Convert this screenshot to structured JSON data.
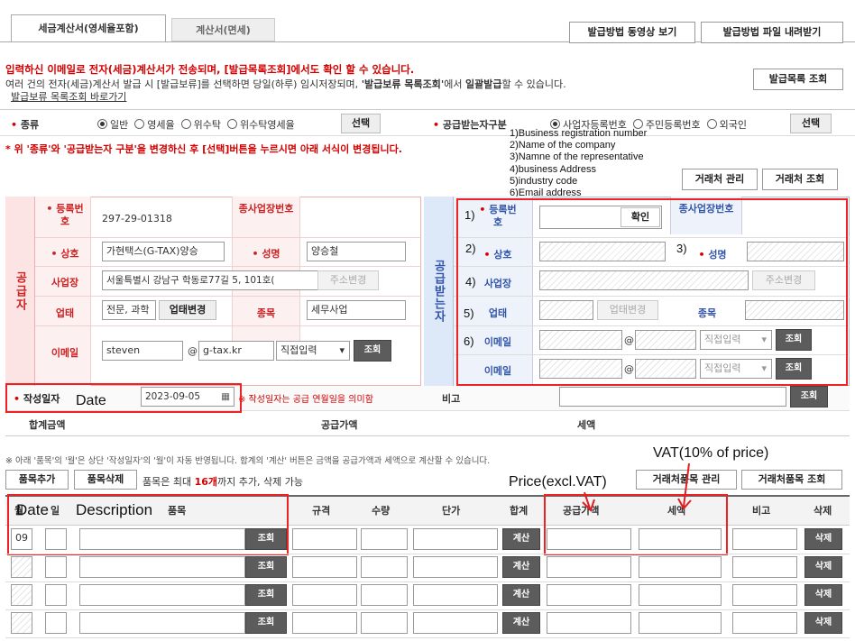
{
  "tabs": [
    "세금계산서(영세율포함)",
    "계산서(면세)"
  ],
  "top_buttons": [
    "발급방법 동영상 보기",
    "발급방법 파일 내려받기"
  ],
  "notice": {
    "line1": "입력하신 이메일로 전자(세금)계산서가 전송되며, [발급목록조회]에서도 확인 할 수 있습니다.",
    "line2a": "여러 건의 전자(세금)계산서 발급 시 [발급보류]를 선택하면 당일(하루) 임시저장되며, ",
    "line2b": "'발급보류 목록조회'",
    "line2c": "에서 ",
    "line2d": "일괄발급",
    "line2e": "할 수 있습니다.",
    "link": "발급보류 목록조회 바로가기",
    "list_button": "발급목록 조회"
  },
  "kind": {
    "label": "종류",
    "options": [
      "일반",
      "영세율",
      "위수탁",
      "위수탁영세율"
    ],
    "selected": 0,
    "button": "선택"
  },
  "recipient_kind": {
    "label": "공급받는자구분",
    "options": [
      "사업자등록번호",
      "주민등록번호",
      "외국인"
    ],
    "selected": 0,
    "button": "선택"
  },
  "warning": "* 위 '종류'와 '공급받는자 구분'을 변경하신 후 [선택]버튼을 누르시면 아래 서식이 변경됩니다.",
  "partner_buttons": [
    "거래처 관리",
    "거래처 조회"
  ],
  "annotation_list": [
    "1)Business registration number",
    "2)Name of the company",
    "3)Namne of the representative",
    "4)business Address",
    "5)industry code",
    "6)Email address"
  ],
  "supplier": {
    "side": "공급자",
    "reg_no_label": "등록번호",
    "reg_no": "297-29-01318",
    "branch_label": "종사업장번호",
    "company_label": "상호",
    "company": "가현택스(G-TAX)양승",
    "name_label": "성명",
    "name": "양승철",
    "address_label": "사업장",
    "address": "서울특별시 강남구 학동로77길 5, 101호(",
    "address_btn": "주소변경",
    "industry_label": "업태",
    "industry": "전문, 과학",
    "industry_btn": "업태변경",
    "item_label": "종목",
    "item": "세무사업",
    "email_label": "이메일",
    "email_id": "steven",
    "at": "@",
    "email_domain": "g-tax.kr",
    "domain_select": "직접입력",
    "lookup": "조회"
  },
  "buyer": {
    "side": "공급받는자",
    "reg_no_label": "등록번호",
    "confirm": "확인",
    "branch_label": "종사업장번호",
    "company_label": "상호",
    "name_label": "성명",
    "address_label": "사업장",
    "address_btn": "주소변경",
    "industry_label": "업태",
    "industry_btn": "업태변경",
    "item_label": "종목",
    "email_label": "이메일",
    "at": "@",
    "domain_select": "직접입력",
    "lookup": "조회",
    "marks": [
      "1)",
      "2)",
      "3)",
      "4)",
      "5)",
      "6)"
    ]
  },
  "date_row": {
    "label": "작성일자",
    "date": "2023-09-05",
    "note": "※ 작성일자는 공급 연월일을 의미함",
    "memo_label": "비고",
    "lookup": "조회",
    "ann": "Date"
  },
  "totals": {
    "total": "합계금액",
    "supply": "공급가액",
    "tax": "세액"
  },
  "items_notice": "※ 아래 '품목'의 '월'은 상단 '작성일자'의 '월'이 자동 반영됩니다. 합계의 '계산' 버튼은 금액을 공급가액과 세액으로 계산할 수 있습니다.",
  "item_buttons": {
    "add": "품목추가",
    "delete": "품목삭제",
    "note_a": "품목은 최대 ",
    "note_b": "16개",
    "note_c": "까지 추가, 삭제 가능",
    "manage": "거래처품목 관리",
    "lookup": "거래처품목 조회"
  },
  "item_ann": {
    "vat": "VAT(10% of price)",
    "price": "Price(excl.VAT)",
    "date": "Date",
    "desc": "Description"
  },
  "item_headers": [
    "월",
    "일",
    "품목",
    "규격",
    "수량",
    "단가",
    "합계",
    "공급가액",
    "세액",
    "비고",
    "삭제"
  ],
  "item_rows": [
    {
      "month": "09"
    },
    {
      "month": ""
    },
    {
      "month": ""
    },
    {
      "month": ""
    }
  ],
  "row_labels": {
    "lookup": "조회",
    "calc": "계산",
    "delete": "삭제"
  },
  "colors": {
    "red": "#d40000",
    "supplier_border": "#f0b0b0",
    "buyer_bg": "#dde8f8",
    "highlight": "#ee2222"
  }
}
